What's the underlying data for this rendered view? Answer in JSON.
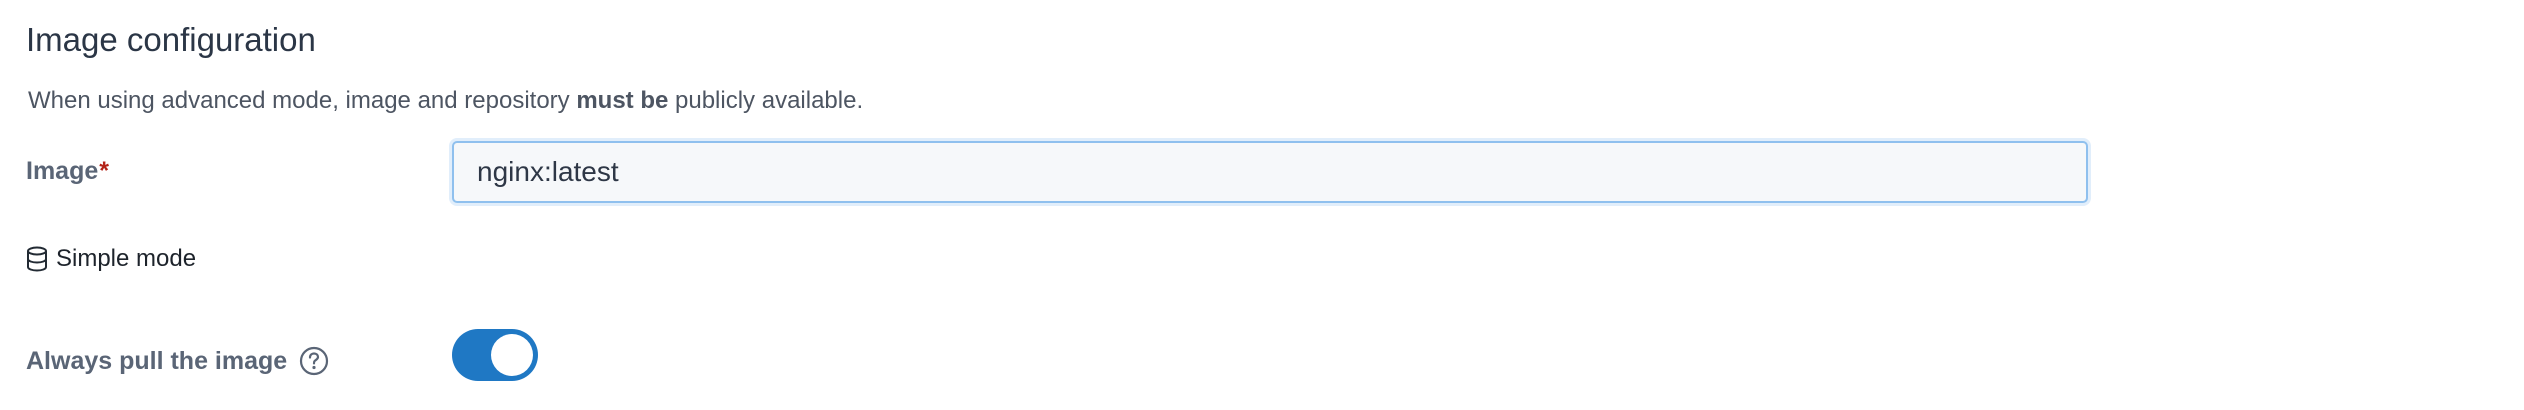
{
  "section": {
    "title": "Image configuration"
  },
  "help": {
    "text_before": "When using advanced mode, image and repository ",
    "text_bold": "must be",
    "text_after": " publicly available."
  },
  "image_field": {
    "label": "Image",
    "required_mark": "*",
    "value": "nginx:latest",
    "placeholder": ""
  },
  "mode_switch": {
    "label": "Simple mode",
    "icon": "database-icon"
  },
  "always_pull": {
    "label": "Always pull the image",
    "help_icon": "question-circle-icon",
    "enabled": true
  },
  "colors": {
    "accent": "#1f78c4",
    "required": "#b42318",
    "label": "#5a6576",
    "title": "#2b3646"
  }
}
